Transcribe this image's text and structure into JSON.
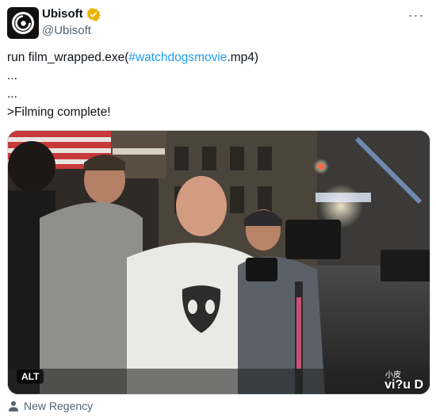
{
  "account": {
    "display_name": "Ubisoft",
    "handle": "@Ubisoft",
    "verified_color": "#e8b400"
  },
  "tweet": {
    "line1_prefix": "run film_wrapped.exe(",
    "hashtag": "#watchdogsmovie",
    "line1_suffix": ".mp4)",
    "line2": "...",
    "line3": "...",
    "line4": ">Filming complete!"
  },
  "media": {
    "alt_label": "ALT",
    "watermark": "vi?u D",
    "watermark_cn": "小皮"
  },
  "credit": {
    "label": "New Regency"
  },
  "colors": {
    "hashtag": "#1d9bf0",
    "secondary_text": "#536471"
  },
  "icons": {
    "more": "more-dots-icon",
    "verified": "verified-badge-icon",
    "credit": "person-tag-icon"
  }
}
